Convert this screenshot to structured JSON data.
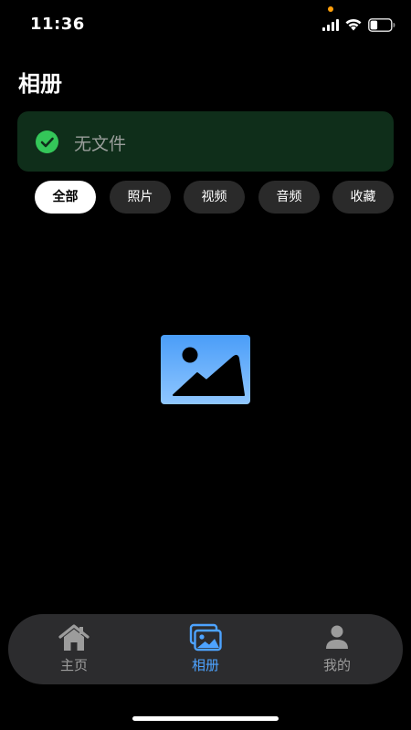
{
  "status_bar": {
    "time": "11:36",
    "battery_level": 0.35,
    "privacy_dot_color": "#ff9f0a"
  },
  "page": {
    "title": "相册"
  },
  "banner": {
    "text": "无文件",
    "icon": "checkmark-circle-icon",
    "icon_color": "#34c759",
    "background": "#0f2e1a"
  },
  "filters": {
    "selected": "全部",
    "items": [
      {
        "label": "全部"
      },
      {
        "label": "照片"
      },
      {
        "label": "视频"
      },
      {
        "label": "音频"
      },
      {
        "label": "收藏"
      }
    ]
  },
  "empty_state": {
    "icon": "photo-placeholder-icon"
  },
  "tab_bar": {
    "active": "相册",
    "accent_color": "#4da3ff",
    "items": [
      {
        "label": "主页",
        "icon": "home-icon"
      },
      {
        "label": "相册",
        "icon": "album-icon"
      },
      {
        "label": "我的",
        "icon": "profile-icon"
      }
    ]
  }
}
